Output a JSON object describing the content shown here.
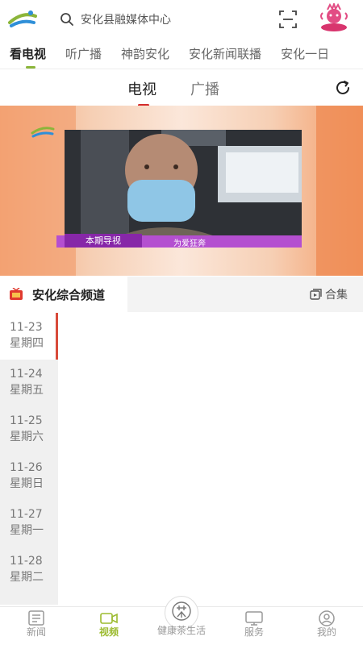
{
  "search": {
    "placeholder": "安化县融媒体中心"
  },
  "channel_tabs": [
    "看电视",
    "听广播",
    "神韵安化",
    "安化新闻联播",
    "安化一日"
  ],
  "sub_tabs": [
    "电视",
    "广播"
  ],
  "video": {
    "caption_label": "本期导视",
    "caption_title": "为爱狂奔"
  },
  "channel": {
    "name": "安化综合频道",
    "collection_label": "合集"
  },
  "dates": [
    {
      "day": "11-23",
      "week": "星期四"
    },
    {
      "day": "11-24",
      "week": "星期五"
    },
    {
      "day": "11-25",
      "week": "星期六"
    },
    {
      "day": "11-26",
      "week": "星期日"
    },
    {
      "day": "11-27",
      "week": "星期一"
    },
    {
      "day": "11-28",
      "week": "星期二"
    }
  ],
  "bottom_nav": [
    "新闻",
    "视频",
    "健康茶生活",
    "服务",
    "我的"
  ],
  "colors": {
    "accent_green": "#9cbb2f",
    "accent_red": "#d32b2b"
  }
}
